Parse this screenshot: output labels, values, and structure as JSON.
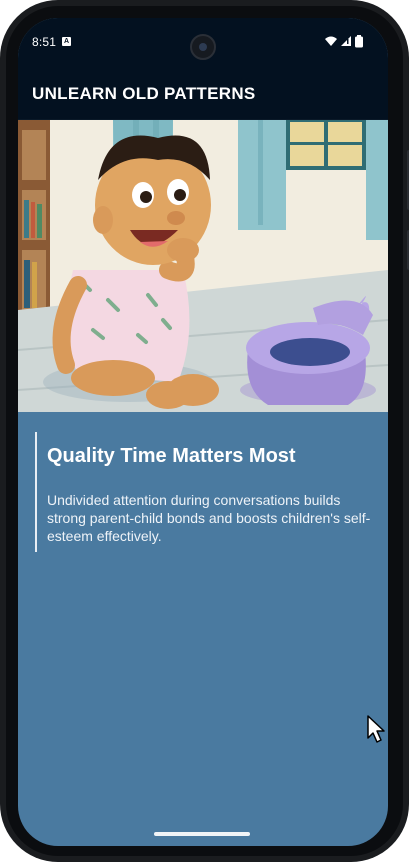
{
  "status_bar": {
    "time": "8:51",
    "notification_icon": "a-box-icon",
    "icons": [
      "wifi-icon",
      "signal-icon",
      "battery-icon"
    ]
  },
  "app_bar": {
    "title": "UNLEARN OLD PATTERNS",
    "background": "#031120"
  },
  "hero_image": {
    "subject": "illustration-toddler-potty"
  },
  "card": {
    "title": "Quality Time Matters Most",
    "body": "Undivided attention during conversations builds strong parent-child bonds and boosts children's self-esteem effectively.",
    "background": "#4a7aa0"
  }
}
